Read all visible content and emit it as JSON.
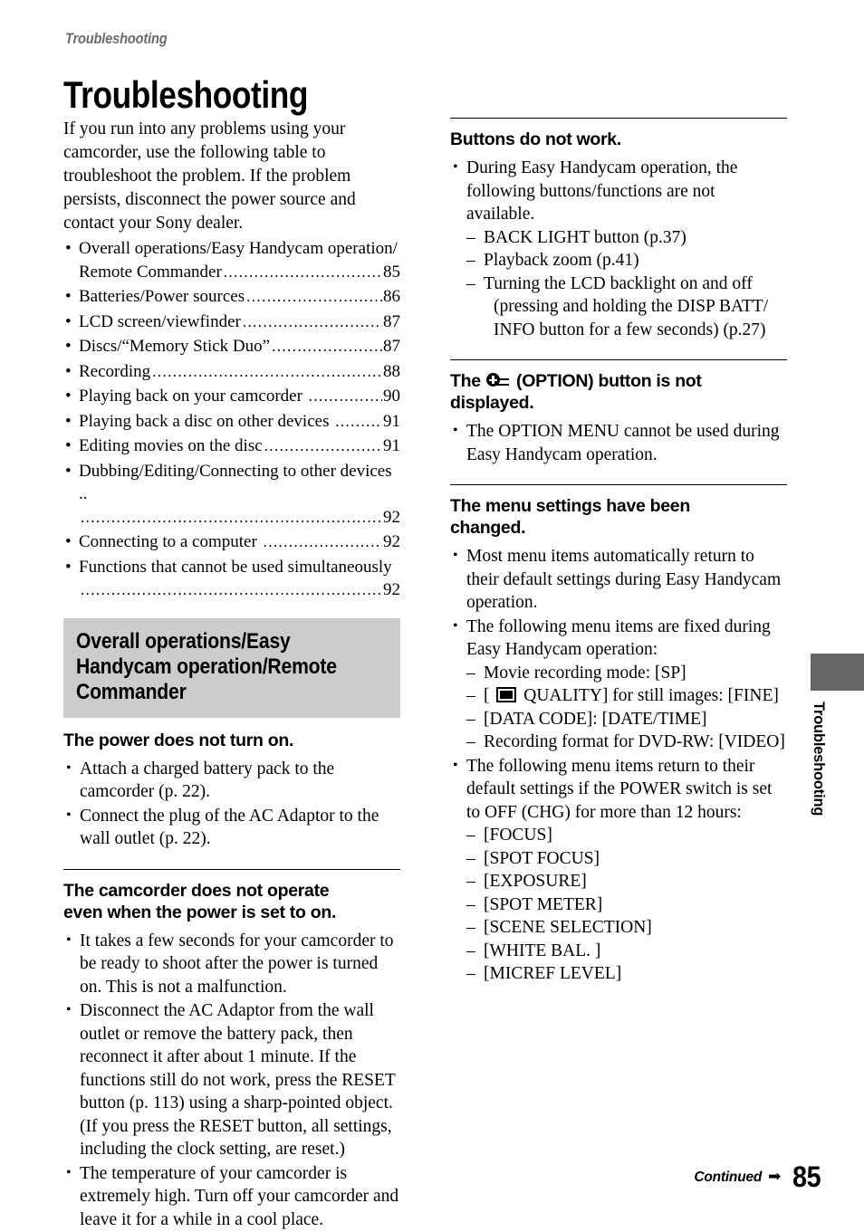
{
  "running_head": "Troubleshooting",
  "page_title": "Troubleshooting",
  "intro": "If you run into any problems using your camcorder, use the following table to troubleshoot the problem. If the problem persists, disconnect the power source and contact your Sony dealer.",
  "bullet_char": "•",
  "dash_char": "–",
  "toc": [
    {
      "label_line1": "Overall operations/Easy Handycam operation/",
      "label_line2": "Remote Commander",
      "page": "85"
    },
    {
      "label_line1": "Batteries/Power sources",
      "page": "86"
    },
    {
      "label_line1": "LCD screen/viewfinder",
      "page": "87"
    },
    {
      "label_line1": "Discs/“Memory Stick Duo”",
      "page": "87"
    },
    {
      "label_line1": "Recording",
      "page": "88"
    },
    {
      "label_line1": "Playing back on your camcorder ",
      "page": "90"
    },
    {
      "label_line1": "Playing back a disc on other devices ",
      "page": "91"
    },
    {
      "label_line1": "Editing movies on the disc",
      "page": "91"
    },
    {
      "label_line1": "Dubbing/Editing/Connecting to other devices ..",
      "page": "92",
      "wrap": true
    },
    {
      "label_line1": "Connecting to a computer ",
      "page": "92"
    },
    {
      "label_line1": "Functions that cannot be used simultaneously",
      "page": "92",
      "wrap": true
    }
  ],
  "section_banner": {
    "line1": "Overall operations/Easy",
    "line2": "Handycam operation/Remote",
    "line3": "Commander"
  },
  "left_sections": [
    {
      "heading": "The power does not turn on.",
      "items": [
        "Attach a charged battery pack to the camcorder (p. 22).",
        "Connect the plug of the AC Adaptor to the wall outlet (p. 22)."
      ]
    },
    {
      "heading_line1": "The camcorder does not operate",
      "heading_line2": "even when the power is set to on.",
      "items": [
        "It takes a few seconds for your camcorder to be ready to shoot after the power is turned on. This is not a malfunction.",
        "Disconnect the AC Adaptor from the wall outlet or remove the battery pack, then reconnect it after about 1 minute. If the functions still do not work, press the RESET button (p. 113) using a sharp-pointed object. (If you press the RESET button, all settings, including the clock setting, are reset.)",
        "The temperature of your camcorder is extremely high. Turn off your camcorder and leave it for a while in a cool place."
      ]
    }
  ],
  "right_sections": {
    "buttons": {
      "heading": "Buttons do not work.",
      "intro": "During Easy Handycam operation, the following buttons/functions are not available.",
      "sub_items": [
        {
          "text": "BACK LIGHT button (p.37)"
        },
        {
          "text": "Playback zoom (p.41)"
        },
        {
          "text": "Turning the LCD backlight on and off",
          "cont": "(pressing and holding the DISP BATT/ INFO button for a few seconds) (p.27)"
        }
      ]
    },
    "option": {
      "heading_pre": "The ",
      "icon": "option-icon",
      "heading_post": " (OPTION) button is not",
      "heading_line2": "displayed.",
      "items": [
        "The OPTION MENU cannot be used during Easy Handycam operation."
      ]
    },
    "menu": {
      "heading_line1": "The menu settings have been",
      "heading_line2": "changed.",
      "item1": "Most menu items automatically return to their default settings during Easy Handycam operation.",
      "item2_intro": "The following menu items are fixed during Easy Handycam operation:",
      "item2_sub": [
        {
          "text": "Movie recording mode: [SP]"
        },
        {
          "pre": "[ ",
          "icon": "quality-icon",
          "post": " QUALITY] for still images: [FINE]"
        },
        {
          "text": "[DATA CODE]: [DATE/TIME]"
        },
        {
          "text": "Recording format for DVD-RW: [VIDEO]"
        }
      ],
      "item3_intro": "The following menu items return to their default settings if the POWER switch is set to OFF (CHG) for more than 12 hours:",
      "item3_sub": [
        {
          "text": "[FOCUS]"
        },
        {
          "text": "[SPOT FOCUS]"
        },
        {
          "text": "[EXPOSURE]"
        },
        {
          "text": "[SPOT METER]"
        },
        {
          "text": "[SCENE SELECTION]"
        },
        {
          "text": "[WHITE BAL. ]"
        },
        {
          "text": "[MICREF LEVEL]"
        }
      ]
    }
  },
  "side_tab": {
    "label": "Troubleshooting",
    "block_color": "#666666"
  },
  "footer": {
    "continued": "Continued",
    "arrow": "➡",
    "page_number": "85"
  },
  "colors": {
    "banner_bg": "#cccccc",
    "running_head": "#6b6b6b",
    "text": "#000000"
  }
}
